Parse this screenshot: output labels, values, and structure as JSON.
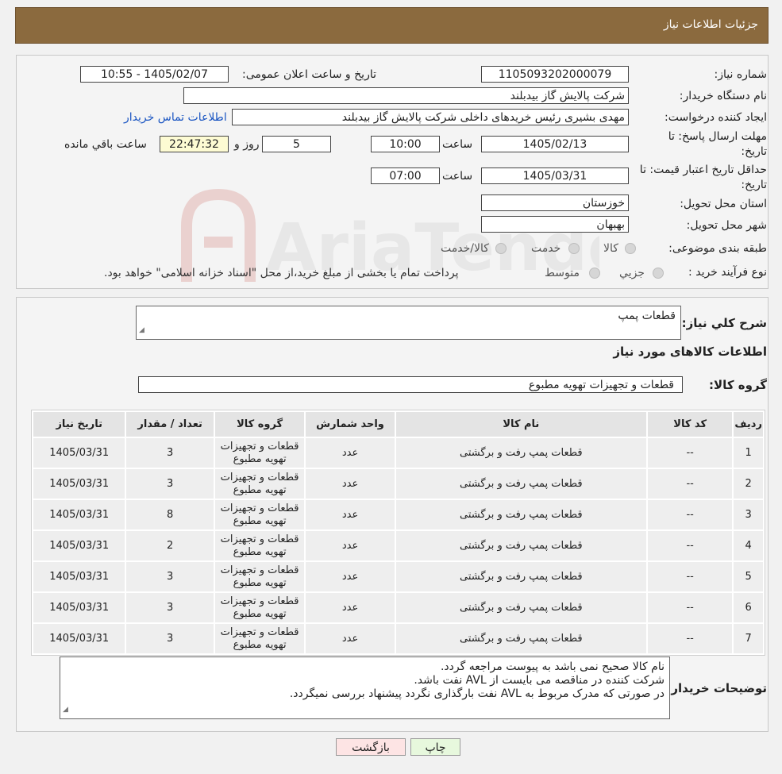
{
  "header": {
    "title": "جزئیات اطلاعات نیاز"
  },
  "watermark": {
    "text": "AriaTender.neT"
  },
  "form": {
    "need_number_label": "شماره نیاز:",
    "need_number": "1105093202000079",
    "announce_datetime_label": "تاریخ و ساعت اعلان عمومی:",
    "announce_datetime": "1405/02/07 - 10:55",
    "buyer_org_label": "نام دستگاه خریدار:",
    "buyer_org": "شرکت پالایش گاز بیدبلند",
    "requester_label": "ایجاد کننده درخواست:",
    "requester": "مهدی بشیری رئیس خریدهای داخلی شرکت پالایش گاز بیدبلند",
    "contact_link": "اطلاعات تماس خریدار",
    "deadline_label_1": "مهلت ارسال پاسخ: تا",
    "deadline_label_2": "تاریخ:",
    "deadline_date": "1405/02/13",
    "time_label": "ساعت",
    "deadline_time": "10:00",
    "days_value": "5",
    "days_label": "روز و",
    "remaining_time": "22:47:32",
    "remaining_label": "ساعت باقي مانده",
    "validity_label_1": "حداقل تاریخ اعتبار قیمت: تا",
    "validity_label_2": "تاریخ:",
    "validity_date": "1405/03/31",
    "validity_time": "07:00",
    "province_label": "استان محل تحویل:",
    "province": "خوزستان",
    "city_label": "شهر محل تحویل:",
    "city": "بهبهان",
    "category_label": "طبقه بندی موضوعی:",
    "category_options": [
      "کالا",
      "خدمت",
      "کالا/خدمت"
    ],
    "process_label": "نوع فرآیند خرید :",
    "process_options": [
      "جزیي",
      "متوسط"
    ],
    "process_note": "پرداخت تمام یا بخشی از مبلغ خرید،از محل \"اسناد خزانه اسلامی\" خواهد بود."
  },
  "summary": {
    "label": "شرح کلي نياز:",
    "value": "قطعات پمپ"
  },
  "goods_section": {
    "title": "اطلاعات کالاهای مورد نیاز",
    "group_label": "گروه کالا:",
    "group_value": "قطعات و تجهیزات تهویه مطبوع"
  },
  "table": {
    "headers": [
      "رديف",
      "کد کالا",
      "نام کالا",
      "واحد شمارش",
      "گروه کالا",
      "تعداد / مقدار",
      "تاریخ نیاز"
    ],
    "rows": [
      [
        "1",
        "--",
        "قطعات پمپ رفت و برگشتی",
        "عدد",
        "قطعات و تجهیزات تهویه مطبوع",
        "3",
        "1405/03/31"
      ],
      [
        "2",
        "--",
        "قطعات پمپ رفت و برگشتی",
        "عدد",
        "قطعات و تجهیزات تهویه مطبوع",
        "3",
        "1405/03/31"
      ],
      [
        "3",
        "--",
        "قطعات پمپ رفت و برگشتی",
        "عدد",
        "قطعات و تجهیزات تهویه مطبوع",
        "8",
        "1405/03/31"
      ],
      [
        "4",
        "--",
        "قطعات پمپ رفت و برگشتی",
        "عدد",
        "قطعات و تجهیزات تهویه مطبوع",
        "2",
        "1405/03/31"
      ],
      [
        "5",
        "--",
        "قطعات پمپ رفت و برگشتی",
        "عدد",
        "قطعات و تجهیزات تهویه مطبوع",
        "3",
        "1405/03/31"
      ],
      [
        "6",
        "--",
        "قطعات پمپ رفت و برگشتی",
        "عدد",
        "قطعات و تجهیزات تهویه مطبوع",
        "3",
        "1405/03/31"
      ],
      [
        "7",
        "--",
        "قطعات پمپ رفت و برگشتی",
        "عدد",
        "قطعات و تجهیزات تهویه مطبوع",
        "3",
        "1405/03/31"
      ]
    ]
  },
  "buyer_notes": {
    "label": "توضیحات خریدار:",
    "lines": [
      "نام کالا صحیح نمی باشد به پیوست مراجعه گردد.",
      "شرکت کننده در مناقصه می بایست از AVL نفت باشد.",
      "در صورتی که مدرک مربوط به AVL نفت بارگذاری نگردد پیشنهاد بررسی نمیگردد."
    ]
  },
  "buttons": {
    "print": "چاپ",
    "back": "بازگشت"
  }
}
